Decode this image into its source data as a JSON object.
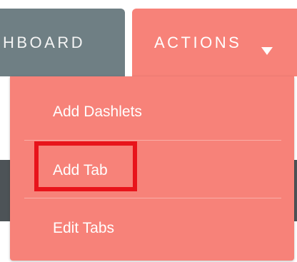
{
  "tabs": {
    "dashboard_label": "HBOARD",
    "actions_label": "ACTIONS"
  },
  "actions_menu": {
    "items": [
      {
        "label": "Add Dashlets"
      },
      {
        "label": "Add Tab"
      },
      {
        "label": "Edit Tabs"
      }
    ]
  },
  "colors": {
    "tab_inactive": "#6f7f84",
    "tab_active": "#f78279",
    "highlight": "#e8141b"
  }
}
